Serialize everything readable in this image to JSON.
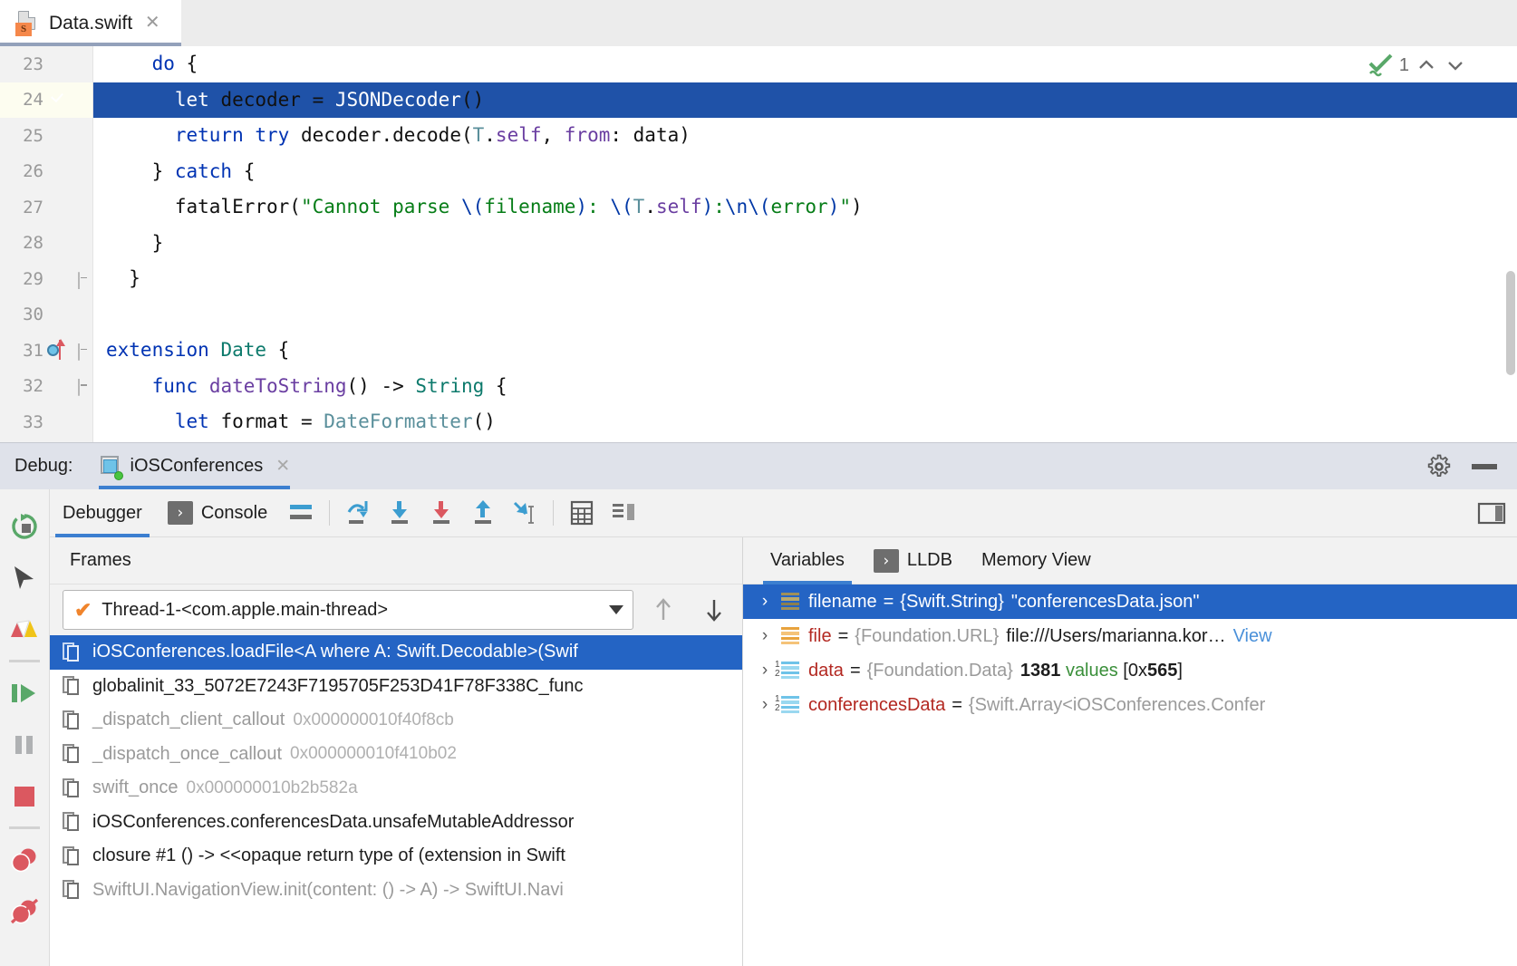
{
  "editor": {
    "tab": {
      "title": "Data.swift",
      "icon": "swift-file-icon",
      "badge": "S",
      "close": "✕"
    },
    "inspection": {
      "count": "1",
      "icon": "inspection-checkmark-icon"
    },
    "lines": [
      {
        "num": "23",
        "marker": null,
        "fold": null,
        "selected": false,
        "text": "do {"
      },
      {
        "num": "24",
        "marker": "breakpoint",
        "fold": null,
        "selected": true,
        "text": "let decoder = JSONDecoder()"
      },
      {
        "num": "25",
        "marker": null,
        "fold": null,
        "selected": false,
        "text": "return try decoder.decode(T.self, from: data)"
      },
      {
        "num": "26",
        "marker": null,
        "fold": null,
        "selected": false,
        "text": "} catch {"
      },
      {
        "num": "27",
        "marker": null,
        "fold": null,
        "selected": false,
        "text": "fatalError(\"Cannot parse \\(filename): \\(T.self):\\n\\(error)\")"
      },
      {
        "num": "28",
        "marker": null,
        "fold": null,
        "selected": false,
        "text": "}"
      },
      {
        "num": "29",
        "marker": null,
        "fold": "end",
        "selected": false,
        "text": "}"
      },
      {
        "num": "30",
        "marker": null,
        "fold": null,
        "selected": false,
        "text": ""
      },
      {
        "num": "31",
        "marker": "extension",
        "fold": "start",
        "selected": false,
        "text": "extension Date {"
      },
      {
        "num": "32",
        "marker": null,
        "fold": "start",
        "selected": false,
        "text": "func dateToString() -> String {"
      },
      {
        "num": "33",
        "marker": null,
        "fold": null,
        "selected": false,
        "text": "let format = DateFormatter()"
      }
    ]
  },
  "debug_header": {
    "label": "Debug:",
    "session": "iOSConferences",
    "session_icon": "run-configuration-icon",
    "close": "✕",
    "settings_icon": "gear-icon",
    "minimize_icon": "minimize-icon"
  },
  "left_rail": [
    {
      "name": "rerun-button",
      "icon": "rerun-icon"
    },
    {
      "name": "show-execution-point-button",
      "icon": "cursor-arrow-icon"
    },
    {
      "name": "layers-button",
      "icon": "layers-icon"
    },
    {
      "name": "resume-program-button",
      "icon": "resume-icon"
    },
    {
      "name": "pause-program-button",
      "icon": "pause-icon"
    },
    {
      "name": "stop-button",
      "icon": "stop-icon"
    },
    {
      "name": "view-breakpoints-button",
      "icon": "breakpoints-icon"
    },
    {
      "name": "mute-breakpoints-button",
      "icon": "mute-breakpoints-icon"
    }
  ],
  "pane_toolbar": {
    "tabs": [
      {
        "label": "Debugger",
        "active": true,
        "icon": null
      },
      {
        "label": "Console",
        "active": false,
        "icon": "console-icon"
      }
    ],
    "buttons": [
      {
        "name": "show-tabs-button",
        "icon": "layout-lines-icon"
      },
      {
        "name": "step-over-button",
        "icon": "step-over-icon"
      },
      {
        "name": "step-into-button",
        "icon": "step-into-icon"
      },
      {
        "name": "force-step-into-button",
        "icon": "force-step-into-icon"
      },
      {
        "name": "step-out-button",
        "icon": "step-out-icon"
      },
      {
        "name": "run-to-cursor-button",
        "icon": "run-to-cursor-icon"
      },
      {
        "name": "evaluate-expression-button",
        "icon": "calculator-icon"
      },
      {
        "name": "layout-settings-button",
        "icon": "layout-settings-icon"
      }
    ],
    "right_button": {
      "name": "restore-layout-button",
      "icon": "restore-layout-icon"
    }
  },
  "frames": {
    "header": "Frames",
    "thread": {
      "label": "Thread-1-<com.apple.main-thread>",
      "check": "✔",
      "caret": "▾"
    },
    "nav": {
      "up": "↑",
      "down": "↓"
    },
    "items": [
      {
        "text": "iOSConferences.loadFile<A where A: Swift.Decodable>(Swif",
        "addr": "",
        "selected": true,
        "dim": false
      },
      {
        "text": "globalinit_33_5072E7243F7195705F253D41F78F338C_func",
        "addr": "",
        "selected": false,
        "dim": false
      },
      {
        "text": "_dispatch_client_callout",
        "addr": "0x000000010f40f8cb",
        "selected": false,
        "dim": true
      },
      {
        "text": "_dispatch_once_callout",
        "addr": "0x000000010f410b02",
        "selected": false,
        "dim": true
      },
      {
        "text": "swift_once",
        "addr": "0x000000010b2b582a",
        "selected": false,
        "dim": true
      },
      {
        "text": "iOSConferences.conferencesData.unsafeMutableAddressor",
        "addr": "",
        "selected": false,
        "dim": false
      },
      {
        "text": "closure #1 () -> <<opaque return type of (extension in Swift",
        "addr": "",
        "selected": false,
        "dim": false
      },
      {
        "text": "SwiftUI.NavigationView.init(content: () -> A) -> SwiftUI.Navi",
        "addr": "",
        "selected": false,
        "dim": true
      }
    ]
  },
  "variables": {
    "tabs": [
      {
        "label": "Variables",
        "active": true,
        "icon": null
      },
      {
        "label": "LLDB",
        "active": false,
        "icon": "console-icon"
      },
      {
        "label": "Memory View",
        "active": false,
        "icon": null
      }
    ],
    "rows": [
      {
        "chevron": "›",
        "icon": "string-variable-icon",
        "icon_color": "#9e8f5a",
        "name": "filename",
        "name_color": "#1d1d1d",
        "eq": "=",
        "type": "{Swift.String}",
        "value": "\"conferencesData.json\"",
        "selected": true,
        "link": "",
        "num_prefix": ""
      },
      {
        "chevron": "›",
        "icon": "object-variable-icon",
        "icon_color": "#e8a33d",
        "name": "file",
        "name_color": "#b32821",
        "eq": "=",
        "type": "{Foundation.URL}",
        "value": "file:///Users/marianna.kor…",
        "selected": false,
        "link": "View",
        "num_prefix": ""
      },
      {
        "chevron": "›",
        "icon": "array-variable-icon",
        "icon_color": "#6fc3e8",
        "name": "data",
        "name_color": "#b32821",
        "eq": "=",
        "type": "{Foundation.Data}",
        "value": "1381 values [0x565]",
        "selected": false,
        "link": "",
        "num_prefix": "1\n2"
      },
      {
        "chevron": "›",
        "icon": "array-variable-icon",
        "icon_color": "#6fc3e8",
        "name": "conferencesData",
        "name_color": "#b32821",
        "eq": "=",
        "type": "{Swift.Array<iOSConferences.Confer",
        "value": "",
        "selected": false,
        "link": "",
        "num_prefix": "1\n2"
      }
    ]
  }
}
